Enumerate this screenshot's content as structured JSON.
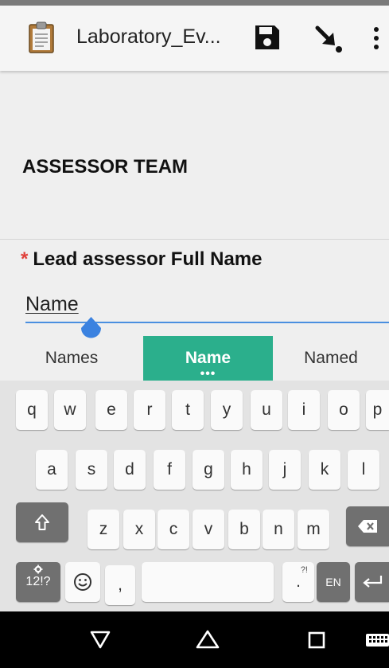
{
  "app_bar": {
    "title": "Laboratory_Ev...",
    "icons": {
      "app": "clipboard-icon",
      "save": "floppy-disk-icon",
      "export": "arrow-down-right-icon",
      "menu": "more-vertical-icon"
    }
  },
  "form": {
    "section_title": "ASSESSOR TEAM",
    "field": {
      "required_mark": "*",
      "label": "Lead assessor Full Name",
      "value": "Name"
    }
  },
  "keyboard": {
    "suggestions": [
      "Names",
      "Name",
      "Named"
    ],
    "suggestion_more": "•••",
    "row1": [
      "q",
      "w",
      "e",
      "r",
      "t",
      "y",
      "u",
      "i",
      "o",
      "p"
    ],
    "row2": [
      "a",
      "s",
      "d",
      "f",
      "g",
      "h",
      "j",
      "k",
      "l"
    ],
    "row3": [
      "z",
      "x",
      "c",
      "v",
      "b",
      "n",
      "m"
    ],
    "symbols_key": "12!?",
    "comma_key": ",",
    "period_key": ".",
    "period_sub": "?!",
    "language_key": "EN",
    "shift_icon": "shift-icon",
    "backspace_icon": "backspace-icon",
    "emoji_icon": "emoji-icon",
    "enter_icon": "enter-icon"
  },
  "navbar": {
    "back_icon": "back-triangle-icon",
    "home_icon": "home-icon",
    "recents_icon": "recents-square-icon",
    "keyboard_icon": "keyboard-icon"
  },
  "colors": {
    "accent": "#2baf8c",
    "input_line": "#4a8fe0",
    "required": "#e0403a",
    "handle": "#3b82e0"
  }
}
